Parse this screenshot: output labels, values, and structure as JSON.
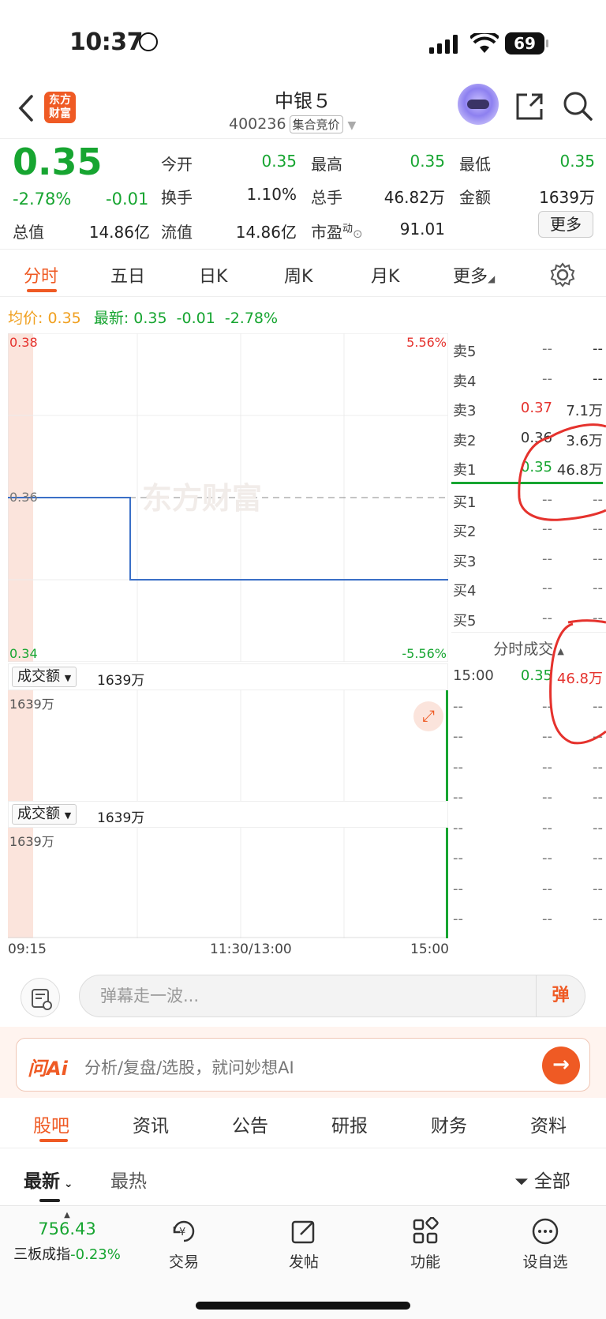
{
  "status": {
    "time": "10:37",
    "battery": "69"
  },
  "header": {
    "logo_text": "东方\n财富",
    "name": "中银５",
    "code": "400236",
    "auction_tag": "集合竞价"
  },
  "quote": {
    "price": "0.35",
    "change_pct": "-2.78%",
    "change_amt": "-0.01",
    "labels": {
      "open": "今开",
      "high": "最高",
      "low": "最低",
      "turnover": "换手",
      "volume": "总手",
      "amount": "金额",
      "total_cap": "总值",
      "float_cap": "流值",
      "pe": "市盈",
      "pe_sup": "动"
    },
    "values": {
      "open": "0.35",
      "high": "0.35",
      "low": "0.35",
      "turnover": "1.10%",
      "volume": "46.82万",
      "amount": "1639万",
      "total_cap": "14.86亿",
      "float_cap": "14.86亿",
      "pe": "91.01"
    },
    "more_btn": "更多"
  },
  "tabs": [
    "分时",
    "五日",
    "日K",
    "周K",
    "月K",
    "更多"
  ],
  "avgline": {
    "avg_label": "均价:",
    "avg_value": "0.35",
    "latest_label": "最新:",
    "latest_value": "0.35",
    "change": "-0.01",
    "pct": "-2.78%"
  },
  "chart_data": {
    "type": "line",
    "title": "",
    "x_labels": [
      "09:15",
      "11:30/13:00",
      "15:00"
    ],
    "y_labels": {
      "top": "0.38",
      "mid": "0.36",
      "bottom": "0.34",
      "top_pct": "5.56%",
      "bottom_pct": "-5.56%"
    },
    "ylim": [
      0.34,
      0.38
    ],
    "reference_price": 0.36,
    "series": [
      {
        "name": "",
        "points": [
          {
            "t": "09:15",
            "v": 0.36
          },
          {
            "t": "09:25",
            "v": 0.36
          },
          {
            "t": "09:25",
            "v": 0.35
          },
          {
            "t": "15:00",
            "v": 0.35
          }
        ]
      }
    ],
    "color": "#3a6fc7",
    "watermark": "东方财富"
  },
  "volume_panels": [
    {
      "selector": "成交额",
      "value": "1639万",
      "axis_top": "1639万"
    },
    {
      "selector": "成交额",
      "value": "1639万",
      "axis_top": "1639万"
    }
  ],
  "orderbook": {
    "asks": [
      {
        "label": "卖5",
        "price": "--",
        "vol": "--"
      },
      {
        "label": "卖4",
        "price": "--",
        "vol": "--"
      },
      {
        "label": "卖3",
        "price": "0.37",
        "vol": "7.1万"
      },
      {
        "label": "卖2",
        "price": "0.36",
        "vol": "3.6万"
      },
      {
        "label": "卖1",
        "price": "0.35",
        "vol": "46.8万"
      }
    ],
    "bids": [
      {
        "label": "买1",
        "price": "--",
        "vol": "--"
      },
      {
        "label": "买2",
        "price": "--",
        "vol": "--"
      },
      {
        "label": "买3",
        "price": "--",
        "vol": "--"
      },
      {
        "label": "买4",
        "price": "--",
        "vol": "--"
      },
      {
        "label": "买5",
        "price": "--",
        "vol": "--"
      }
    ],
    "trades_title": "分时成交",
    "trades": [
      {
        "time": "15:00",
        "price": "0.35",
        "vol": "46.8万"
      },
      {
        "time": "--",
        "price": "--",
        "vol": "--"
      },
      {
        "time": "--",
        "price": "--",
        "vol": "--"
      },
      {
        "time": "--",
        "price": "--",
        "vol": "--"
      },
      {
        "time": "--",
        "price": "--",
        "vol": "--"
      },
      {
        "time": "--",
        "price": "--",
        "vol": "--"
      },
      {
        "time": "--",
        "price": "--",
        "vol": "--"
      },
      {
        "time": "--",
        "price": "--",
        "vol": "--"
      },
      {
        "time": "--",
        "price": "--",
        "vol": "--"
      }
    ]
  },
  "danmu": {
    "placeholder": "弹幕走一波...",
    "btn": "弹"
  },
  "ai": {
    "logo": "问Ai",
    "text": "分析/复盘/选股，就问妙想AI"
  },
  "bottom_tabs": [
    "股吧",
    "资讯",
    "公告",
    "研报",
    "财务",
    "资料"
  ],
  "sub_tabs": {
    "latest": "最新",
    "hot": "最热",
    "filter": "全部"
  },
  "nav": {
    "index_value": "756.43",
    "index_name": "三板成指",
    "index_pct": "-0.23%",
    "items": [
      "交易",
      "发帖",
      "功能",
      "设自选"
    ]
  }
}
